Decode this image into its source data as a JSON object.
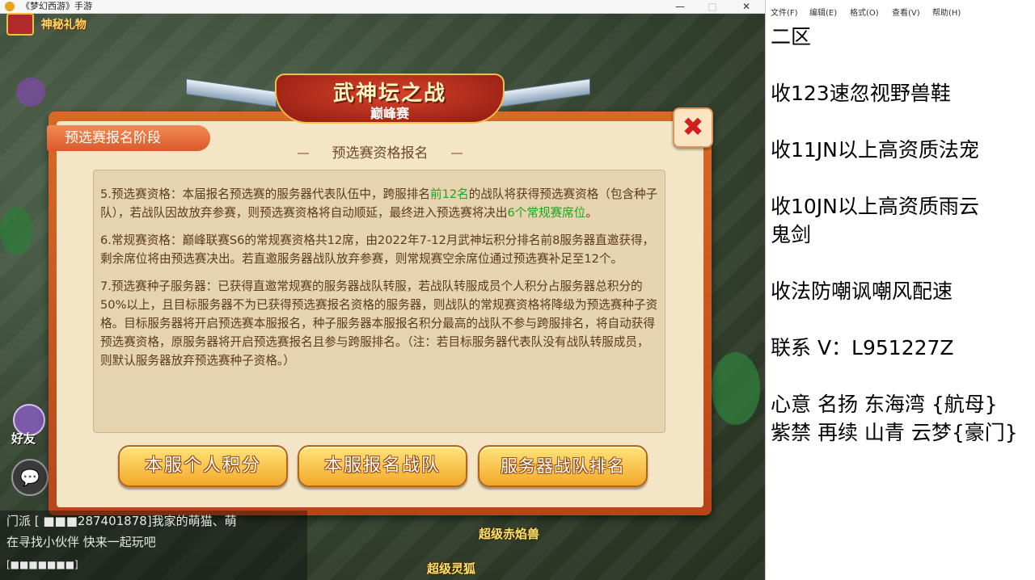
{
  "game_window": {
    "title": "《梦幻西游》手游",
    "minimize_glyph": "—",
    "maximize_glyph": "□",
    "close_glyph": "✕",
    "mystery_gift_label": "神秘礼物"
  },
  "dialog": {
    "banner_title": "武神坛之战",
    "banner_subtitle": "巅峰赛",
    "stage_tab": "预选赛报名阶段",
    "close_glyph": "✖",
    "section_title": "预选赛资格报名",
    "rules": [
      {
        "before": "5.预选赛资格：本届报名预选赛的服务器代表队伍中，跨服排名",
        "highlight": "前12名",
        "middle": "的战队将获得预选赛资格（包含种子队），若战队因故放弃参赛，则预选赛资格将自动顺延，最终进入预选赛将决出",
        "highlight2": "6个常规赛席位",
        "after": "。"
      },
      {
        "text": "6.常规赛资格：巅峰联赛S6的常规赛资格共12席，由2022年7-12月武神坛积分排名前8服务器直邀获得，剩余席位将由预选赛决出。若直邀服务器战队放弃参赛，则常规赛空余席位通过预选赛补足至12个。"
      },
      {
        "text": "7.预选赛种子服务器：已获得直邀常规赛的服务器战队转服，若战队转服成员个人积分占服务器总积分的50%以上，且目标服务器不为已获得预选赛报名资格的服务器，则战队的常规赛资格将降级为预选赛种子资格。目标服务器将开启预选赛本服报名，种子服务器本服报名积分最高的战队不参与跨服排名，将自动获得预选赛资格，原服务器将开启预选赛报名且参与跨服排名。（注：若目标服务器代表队没有战队转服成员，则默认服务器放弃预选赛种子资格。）"
      }
    ],
    "buttons": {
      "personal_score": "本服个人积分",
      "registered_teams": "本服报名战队",
      "server_ranking": "服务器战队排名"
    }
  },
  "scene": {
    "friend_label": "好友",
    "chat_icon": "💬",
    "chat_lines": [
      "门派 [ ■■■287401878]我家的萌猫、萌",
      "在寻找小伙伴   快来一起玩吧",
      "[■■■■■■■]"
    ],
    "labels": {
      "super_red_flame_beast": "超级赤焰兽",
      "super_spirit_fox": "超级灵狐"
    }
  },
  "notepad": {
    "menu": {
      "file": "文件(F)",
      "edit": "编辑(E)",
      "format": "格式(O)",
      "view": "查看(V)",
      "help": "帮助(H)"
    },
    "lines": [
      "二区",
      "",
      "收123速忽视野兽鞋",
      "",
      "收11JN以上高资质法宠",
      "",
      "收10JN以上高资质雨云",
      "鬼剑",
      "",
      "收法防嘲讽嘲风配速",
      "",
      "联系 V：L951227Z",
      "",
      "心意 名扬 东海湾 {航母}",
      "紫禁 再续 山青 云梦{豪门}"
    ]
  }
}
